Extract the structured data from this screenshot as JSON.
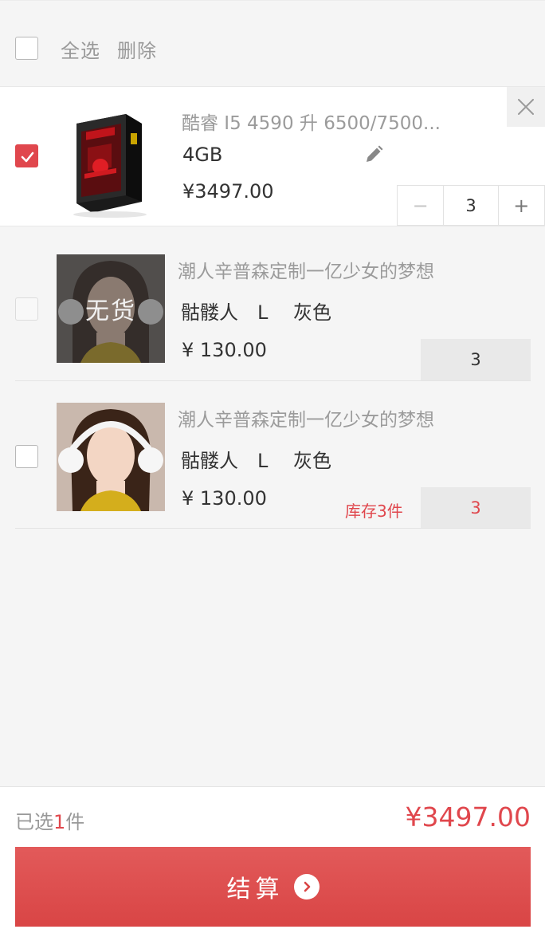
{
  "toolbar": {
    "select_all": "全选",
    "delete": "删除"
  },
  "items": [
    {
      "title": "酷睿 I5 4590 升 6500/7500...",
      "spec": "4GB",
      "price": "¥3497.00",
      "quantity": "3",
      "checked": true,
      "minus": "−",
      "plus": "+"
    },
    {
      "title": "潮人辛普森定制一亿少女的梦想",
      "spec": "骷髅人　L　 灰色",
      "price": "¥ 130.00",
      "quantity": "3",
      "status_overlay": "无货",
      "checked": false
    },
    {
      "title": "潮人辛普森定制一亿少女的梦想",
      "spec": "骷髅人　L　 灰色",
      "price": "¥ 130.00",
      "quantity": "3",
      "stock_note": "库存3件",
      "checked": false
    }
  ],
  "footer": {
    "selected_prefix": "已选",
    "selected_count": "1",
    "selected_suffix": "件",
    "total": "¥3497.00",
    "checkout_label": "结算"
  },
  "colors": {
    "accent": "#e0474d",
    "background": "#f5f5f5"
  },
  "icons": [
    "checkmark-icon",
    "close-icon",
    "pencil-icon",
    "chevron-right-icon"
  ]
}
